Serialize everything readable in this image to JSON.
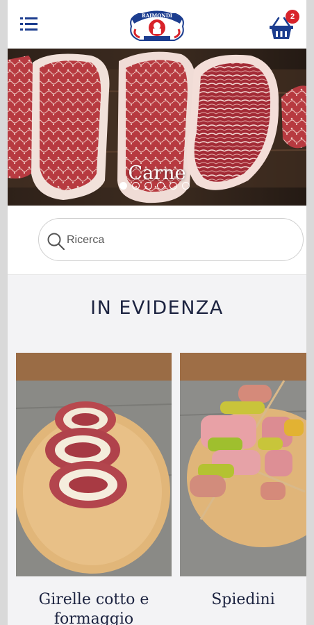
{
  "header": {
    "menu_icon": "hamburger-menu-icon",
    "logo_text": "RAIMONDI",
    "cart_icon": "shopping-basket-icon",
    "cart_count": "2",
    "badge_color": "#d8232a",
    "brand_color": "#1c3d8f"
  },
  "hero": {
    "title": "Carne",
    "slide_count": 6,
    "active_slide": 0
  },
  "search": {
    "placeholder": "Ricerca",
    "icon": "search-icon"
  },
  "featured": {
    "title": "IN EVIDENZA",
    "items": [
      {
        "name": "Girelle cotto e formaggio"
      },
      {
        "name": "Spiedini"
      }
    ]
  }
}
